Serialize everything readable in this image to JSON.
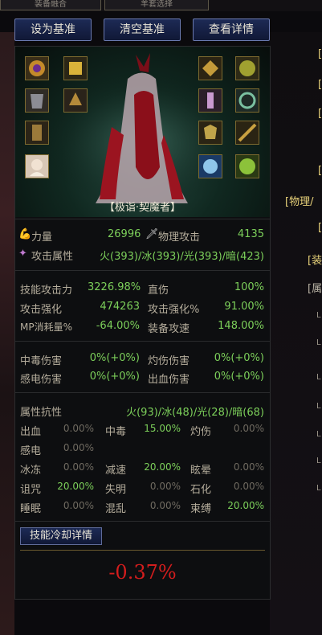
{
  "top_tabs": [
    "装备融合",
    "羊套选择"
  ],
  "buttons": {
    "set_base": "设为基准",
    "clear_base": "清空基准",
    "view_details": "查看详情"
  },
  "character": {
    "name": "【极诣·契魔者】"
  },
  "stats_top": {
    "strength_label": "力量",
    "strength_value": "26996",
    "phys_atk_label": "物理攻击",
    "phys_atk_value": "4135",
    "element_label": "攻击属性",
    "element_value": "火(393)/冰(393)/光(393)/暗(423)"
  },
  "stats_main": [
    {
      "label": "技能攻击力",
      "value": "3226.98%",
      "label2": "直伤",
      "value2": "100%"
    },
    {
      "label": "攻击强化",
      "value": "474263",
      "label2": "攻击强化%",
      "value2": "91.00%"
    },
    {
      "label": "MP消耗量%",
      "value": "-64.00%",
      "label2": "装备攻速",
      "value2": "148.00%"
    }
  ],
  "stats_dot": [
    {
      "label": "中毒伤害",
      "value": "0%(+0%)",
      "label2": "灼伤伤害",
      "value2": "0%(+0%)"
    },
    {
      "label": "感电伤害",
      "value": "0%(+0%)",
      "label2": "出血伤害",
      "value2": "0%(+0%)"
    }
  ],
  "resist": {
    "label": "属性抗性",
    "value": "火(93)/冰(48)/光(28)/暗(68)",
    "rows": [
      [
        {
          "l": "出血",
          "v": "0.00%"
        },
        {
          "l": "中毒",
          "v": "15.00%"
        },
        {
          "l": "灼伤",
          "v": "0.00%"
        }
      ],
      [
        {
          "l": "感电",
          "v": "0.00%"
        }
      ],
      [
        {
          "l": "冰冻",
          "v": "0.00%"
        },
        {
          "l": "减速",
          "v": "20.00%"
        },
        {
          "l": "眩晕",
          "v": "0.00%"
        }
      ],
      [
        {
          "l": "诅咒",
          "v": "20.00%"
        },
        {
          "l": "失明",
          "v": "0.00%"
        },
        {
          "l": "石化",
          "v": "0.00%"
        }
      ],
      [
        {
          "l": "睡眠",
          "v": "0.00%"
        },
        {
          "l": "混乱",
          "v": "0.00%"
        },
        {
          "l": "束缚",
          "v": "20.00%"
        }
      ]
    ]
  },
  "cooldown_button": "技能冷却详情",
  "result": "-0.37%",
  "right_fragments": [
    "[",
    "[",
    "[",
    "[",
    "[物理/",
    "[",
    "[装",
    "[属",
    "L",
    "L",
    "L",
    "L",
    "L",
    "L",
    "L"
  ]
}
